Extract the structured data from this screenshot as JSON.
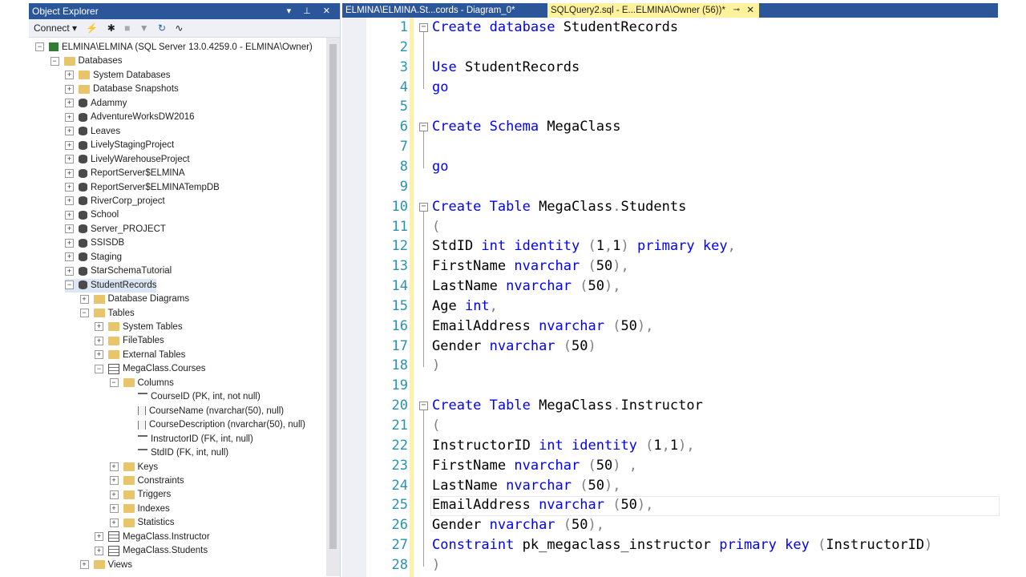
{
  "object_explorer": {
    "title": "Object Explorer",
    "title_buttons": "▾ ⊥ ✕",
    "toolbar": {
      "connect_label": "Connect ▾"
    },
    "tree": [
      {
        "label": "ELMINA\\ELMINA (SQL Server 13.0.4259.0 - ELMINA\\Owner)",
        "depth": 0,
        "icon": "server-icon",
        "exp": "−"
      },
      {
        "label": "Databases",
        "depth": 1,
        "icon": "folder-icon",
        "exp": "−"
      },
      {
        "label": "System Databases",
        "depth": 2,
        "icon": "folder-icon",
        "exp": "+"
      },
      {
        "label": "Database Snapshots",
        "depth": 2,
        "icon": "folder-icon",
        "exp": "+"
      },
      {
        "label": "Adammy",
        "depth": 2,
        "icon": "database-icon",
        "exp": "+"
      },
      {
        "label": "AdventureWorksDW2016",
        "depth": 2,
        "icon": "database-icon",
        "exp": "+"
      },
      {
        "label": "Leaves",
        "depth": 2,
        "icon": "database-icon",
        "exp": "+"
      },
      {
        "label": "LivelyStagingProject",
        "depth": 2,
        "icon": "database-icon",
        "exp": "+"
      },
      {
        "label": "LivelyWarehouseProject",
        "depth": 2,
        "icon": "database-icon",
        "exp": "+"
      },
      {
        "label": "ReportServer$ELMINA",
        "depth": 2,
        "icon": "database-icon",
        "exp": "+"
      },
      {
        "label": "ReportServer$ELMINATempDB",
        "depth": 2,
        "icon": "database-icon",
        "exp": "+"
      },
      {
        "label": "RiverCorp_project",
        "depth": 2,
        "icon": "database-icon",
        "exp": "+"
      },
      {
        "label": "School",
        "depth": 2,
        "icon": "database-icon",
        "exp": "+"
      },
      {
        "label": "Server_PROJECT",
        "depth": 2,
        "icon": "database-icon",
        "exp": "+"
      },
      {
        "label": "SSISDB",
        "depth": 2,
        "icon": "database-icon",
        "exp": "+"
      },
      {
        "label": "Staging",
        "depth": 2,
        "icon": "database-icon",
        "exp": "+"
      },
      {
        "label": "StarSchemaTutorial",
        "depth": 2,
        "icon": "database-icon",
        "exp": "+"
      },
      {
        "label": "StudentRecords",
        "depth": 2,
        "icon": "database-icon",
        "exp": "−",
        "selected": true
      },
      {
        "label": "Database Diagrams",
        "depth": 3,
        "icon": "folder-icon",
        "exp": "+"
      },
      {
        "label": "Tables",
        "depth": 3,
        "icon": "folder-icon",
        "exp": "−"
      },
      {
        "label": "System Tables",
        "depth": 4,
        "icon": "folder-icon",
        "exp": "+"
      },
      {
        "label": "FileTables",
        "depth": 4,
        "icon": "folder-icon",
        "exp": "+"
      },
      {
        "label": "External Tables",
        "depth": 4,
        "icon": "folder-icon",
        "exp": "+"
      },
      {
        "label": "MegaClass.Courses",
        "depth": 4,
        "icon": "table-icon",
        "exp": "−"
      },
      {
        "label": "Columns",
        "depth": 5,
        "icon": "folder-icon",
        "exp": "−"
      },
      {
        "label": "CourseID (PK, int, not null)",
        "depth": 6,
        "icon": "primary-key-icon",
        "exp": ""
      },
      {
        "label": "CourseName (nvarchar(50), null)",
        "depth": 6,
        "icon": "column-icon",
        "exp": ""
      },
      {
        "label": "CourseDescription (nvarchar(50), null)",
        "depth": 6,
        "icon": "column-icon",
        "exp": ""
      },
      {
        "label": "InstructorID (FK, int, null)",
        "depth": 6,
        "icon": "foreign-key-icon",
        "exp": ""
      },
      {
        "label": "StdID (FK, int, null)",
        "depth": 6,
        "icon": "foreign-key-icon",
        "exp": ""
      },
      {
        "label": "Keys",
        "depth": 5,
        "icon": "folder-icon",
        "exp": "+"
      },
      {
        "label": "Constraints",
        "depth": 5,
        "icon": "folder-icon",
        "exp": "+"
      },
      {
        "label": "Triggers",
        "depth": 5,
        "icon": "folder-icon",
        "exp": "+"
      },
      {
        "label": "Indexes",
        "depth": 5,
        "icon": "folder-icon",
        "exp": "+"
      },
      {
        "label": "Statistics",
        "depth": 5,
        "icon": "folder-icon",
        "exp": "+"
      },
      {
        "label": "MegaClass.Instructor",
        "depth": 4,
        "icon": "table-icon",
        "exp": "+"
      },
      {
        "label": "MegaClass.Students",
        "depth": 4,
        "icon": "table-icon",
        "exp": "+"
      },
      {
        "label": "Views",
        "depth": 3,
        "icon": "folder-icon",
        "exp": "+"
      }
    ]
  },
  "tabs": {
    "tab1": "ELMINA\\ELMINA.St...cords - Diagram_0*",
    "tab2": "SQLQuery2.sql - E...ELMINA\\Owner (56))*",
    "tab2_pin": "⊸",
    "tab2_close": "✕"
  },
  "editor": {
    "lines": [
      {
        "n": "1",
        "t": [
          [
            "kw",
            "Create database"
          ],
          [
            "",
            "StudentRecords"
          ]
        ]
      },
      {
        "n": "2",
        "t": []
      },
      {
        "n": "3",
        "t": [
          [
            "kw",
            "Use"
          ],
          [
            "",
            "StudentRecords"
          ]
        ]
      },
      {
        "n": "4",
        "t": [
          [
            "kw",
            "go"
          ]
        ]
      },
      {
        "n": "5",
        "t": []
      },
      {
        "n": "6",
        "t": [
          [
            "kw",
            "Create Schema"
          ],
          [
            "",
            "MegaClass"
          ]
        ]
      },
      {
        "n": "7",
        "t": []
      },
      {
        "n": "8",
        "t": [
          [
            "kw",
            "go"
          ]
        ]
      },
      {
        "n": "9",
        "t": []
      },
      {
        "n": "10",
        "t": [
          [
            "kw",
            "Create Table"
          ],
          [
            "",
            "MegaClass"
          ],
          [
            "gr",
            "."
          ],
          [
            "",
            "Students"
          ]
        ]
      },
      {
        "n": "11",
        "t": [
          [
            "gr",
            "("
          ]
        ]
      },
      {
        "n": "12",
        "t": [
          [
            "",
            "StdID "
          ],
          [
            "kw",
            "int identity"
          ],
          [
            "gr",
            " ("
          ],
          [
            "",
            "1"
          ],
          [
            "gr",
            ","
          ],
          [
            "",
            "1"
          ],
          [
            "gr",
            ") "
          ],
          [
            "kw",
            "primary key"
          ],
          [
            "gr",
            ","
          ]
        ]
      },
      {
        "n": "13",
        "t": [
          [
            "",
            "FirstName "
          ],
          [
            "kw",
            "nvarchar"
          ],
          [
            "gr",
            " ("
          ],
          [
            "",
            "50"
          ],
          [
            "gr",
            "),"
          ]
        ]
      },
      {
        "n": "14",
        "t": [
          [
            "",
            "LastName "
          ],
          [
            "kw",
            "nvarchar"
          ],
          [
            "gr",
            " ("
          ],
          [
            "",
            "50"
          ],
          [
            "gr",
            "),"
          ]
        ]
      },
      {
        "n": "15",
        "t": [
          [
            "",
            "Age "
          ],
          [
            "kw",
            "int"
          ],
          [
            "gr",
            ","
          ]
        ]
      },
      {
        "n": "16",
        "t": [
          [
            "",
            "EmailAddress "
          ],
          [
            "kw",
            "nvarchar"
          ],
          [
            "gr",
            " ("
          ],
          [
            "",
            "50"
          ],
          [
            "gr",
            "),"
          ]
        ]
      },
      {
        "n": "17",
        "t": [
          [
            "",
            "Gender "
          ],
          [
            "kw",
            "nvarchar"
          ],
          [
            "gr",
            " ("
          ],
          [
            "",
            "50"
          ],
          [
            "gr",
            ")"
          ]
        ]
      },
      {
        "n": "18",
        "t": [
          [
            "gr",
            ")"
          ]
        ]
      },
      {
        "n": "19",
        "t": []
      },
      {
        "n": "20",
        "t": [
          [
            "kw",
            "Create Table"
          ],
          [
            "",
            "MegaClass"
          ],
          [
            "gr",
            "."
          ],
          [
            "",
            "Instructor"
          ]
        ]
      },
      {
        "n": "21",
        "t": [
          [
            "gr",
            "("
          ]
        ]
      },
      {
        "n": "22",
        "t": [
          [
            "",
            "InstructorID "
          ],
          [
            "kw",
            "int identity"
          ],
          [
            "gr",
            " ("
          ],
          [
            "",
            "1"
          ],
          [
            "gr",
            ","
          ],
          [
            "",
            "1"
          ],
          [
            "gr",
            "),"
          ]
        ]
      },
      {
        "n": "23",
        "t": [
          [
            "",
            "FirstName "
          ],
          [
            "kw",
            "nvarchar"
          ],
          [
            "gr",
            " ("
          ],
          [
            "",
            "50"
          ],
          [
            "gr",
            ") ,"
          ]
        ]
      },
      {
        "n": "24",
        "t": [
          [
            "",
            "LastName "
          ],
          [
            "kw",
            "nvarchar"
          ],
          [
            "gr",
            " ("
          ],
          [
            "",
            "50"
          ],
          [
            "gr",
            "),"
          ]
        ]
      },
      {
        "n": "25",
        "t": [
          [
            "",
            "EmailAddress "
          ],
          [
            "kw",
            "nvarchar"
          ],
          [
            "gr",
            " ("
          ],
          [
            "",
            "50"
          ],
          [
            "gr",
            "),"
          ]
        ]
      },
      {
        "n": "26",
        "t": [
          [
            "",
            "Gender "
          ],
          [
            "kw",
            "nvarchar"
          ],
          [
            "gr",
            " ("
          ],
          [
            "",
            "50"
          ],
          [
            "gr",
            "),"
          ]
        ]
      },
      {
        "n": "27",
        "t": [
          [
            "kw",
            "Constraint"
          ],
          [
            "",
            "pk_megaclass_instructor "
          ],
          [
            "kw",
            "primary key"
          ],
          [
            "gr",
            " ("
          ],
          [
            "",
            "InstructorID"
          ],
          [
            "gr",
            ")"
          ]
        ]
      },
      {
        "n": "28",
        "t": [
          [
            "gr",
            ")"
          ]
        ]
      }
    ]
  }
}
